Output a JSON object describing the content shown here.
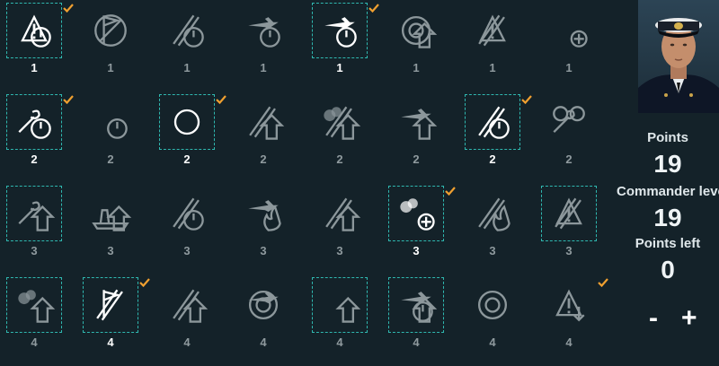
{
  "skills": [
    {
      "row": 0,
      "col": 0,
      "icon": "warning-target-icon",
      "cost": "1",
      "selected": true,
      "checked": true
    },
    {
      "row": 0,
      "col": 1,
      "icon": "no-flag-icon",
      "cost": "1",
      "selected": false,
      "checked": false
    },
    {
      "row": 0,
      "col": 2,
      "icon": "torpedo-timer-icon",
      "cost": "1",
      "selected": false,
      "checked": false
    },
    {
      "row": 0,
      "col": 3,
      "icon": "aircraft-timer-icon",
      "cost": "1",
      "selected": false,
      "checked": false
    },
    {
      "row": 0,
      "col": 4,
      "icon": "fighters-target-icon",
      "cost": "1",
      "selected": true,
      "checked": true
    },
    {
      "row": 0,
      "col": 5,
      "icon": "radar-upgrade-icon",
      "cost": "1",
      "selected": false,
      "checked": false
    },
    {
      "row": 0,
      "col": 6,
      "icon": "shell-warning-icon",
      "cost": "1",
      "selected": false,
      "checked": false
    },
    {
      "row": 0,
      "col": 7,
      "icon": "bomb-plus-icon",
      "cost": "1",
      "selected": false,
      "checked": false
    },
    {
      "row": 1,
      "col": 0,
      "icon": "wrench-timer-icon",
      "cost": "2",
      "selected": true,
      "checked": true
    },
    {
      "row": 1,
      "col": 1,
      "icon": "stopwatch-icon",
      "cost": "2",
      "selected": false,
      "checked": false
    },
    {
      "row": 1,
      "col": 2,
      "icon": "turret-rotation-icon",
      "cost": "2",
      "selected": true,
      "checked": true
    },
    {
      "row": 1,
      "col": 3,
      "icon": "torpedo-upgrade-icon",
      "cost": "2",
      "selected": false,
      "checked": false
    },
    {
      "row": 1,
      "col": 4,
      "icon": "smoke-gun-upgrade-icon",
      "cost": "2",
      "selected": false,
      "checked": false
    },
    {
      "row": 1,
      "col": 5,
      "icon": "aircraft-crosshair-upgrade-icon",
      "cost": "2",
      "selected": false,
      "checked": false
    },
    {
      "row": 1,
      "col": 6,
      "icon": "shells-timer-icon",
      "cost": "2",
      "selected": true,
      "checked": true
    },
    {
      "row": 1,
      "col": 7,
      "icon": "gears-wrench-icon",
      "cost": "2",
      "selected": false,
      "checked": false
    },
    {
      "row": 2,
      "col": 0,
      "icon": "wrench-upgrade-icon",
      "cost": "3",
      "selected": true,
      "checked": false
    },
    {
      "row": 2,
      "col": 1,
      "icon": "ship-upgrade-icon",
      "cost": "3",
      "selected": false,
      "checked": false
    },
    {
      "row": 2,
      "col": 2,
      "icon": "guns-timer-icon",
      "cost": "3",
      "selected": false,
      "checked": false
    },
    {
      "row": 2,
      "col": 3,
      "icon": "aircraft-fire-icon",
      "cost": "3",
      "selected": false,
      "checked": false
    },
    {
      "row": 2,
      "col": 4,
      "icon": "aa-shells-upgrade-icon",
      "cost": "3",
      "selected": false,
      "checked": false
    },
    {
      "row": 2,
      "col": 5,
      "icon": "aa-smoke-plus-icon",
      "cost": "3",
      "selected": true,
      "checked": true
    },
    {
      "row": 2,
      "col": 6,
      "icon": "shell-fire-icon",
      "cost": "3",
      "selected": false,
      "checked": false
    },
    {
      "row": 2,
      "col": 7,
      "icon": "torpedo-warning-icon",
      "cost": "3",
      "selected": true,
      "checked": false
    },
    {
      "row": 3,
      "col": 0,
      "icon": "smoke-upgrade-icon",
      "cost": "4",
      "selected": true,
      "checked": false
    },
    {
      "row": 3,
      "col": 1,
      "icon": "shell-flag-icon",
      "cost": "4",
      "selected": true,
      "checked": true
    },
    {
      "row": 3,
      "col": 2,
      "icon": "crossed-guns-upgrade-icon",
      "cost": "4",
      "selected": false,
      "checked": false
    },
    {
      "row": 3,
      "col": 3,
      "icon": "aircraft-radar-icon",
      "cost": "4",
      "selected": false,
      "checked": false
    },
    {
      "row": 3,
      "col": 4,
      "icon": "aa-double-upgrade-icon",
      "cost": "4",
      "selected": true,
      "checked": false
    },
    {
      "row": 3,
      "col": 5,
      "icon": "aircraft-target-upgrade-icon",
      "cost": "4",
      "selected": true,
      "checked": false
    },
    {
      "row": 3,
      "col": 6,
      "icon": "radar-sweep-icon",
      "cost": "4",
      "selected": false,
      "checked": false
    },
    {
      "row": 3,
      "col": 7,
      "icon": "warning-download-icon",
      "cost": "4",
      "selected": false,
      "checked": true
    }
  ],
  "sidebar": {
    "points_label": "Points",
    "points_value": "19",
    "commander_label": "Commander level",
    "commander_value": "19",
    "points_left_label": "Points left",
    "points_left_value": "0",
    "minus_label": "-",
    "plus_label": "+"
  },
  "colors": {
    "background": "#142229",
    "selection_outline": "#2fb8b0",
    "checkmark": "#f0a030",
    "icon_active": "#ffffff",
    "icon_inactive": "#8c979b"
  }
}
